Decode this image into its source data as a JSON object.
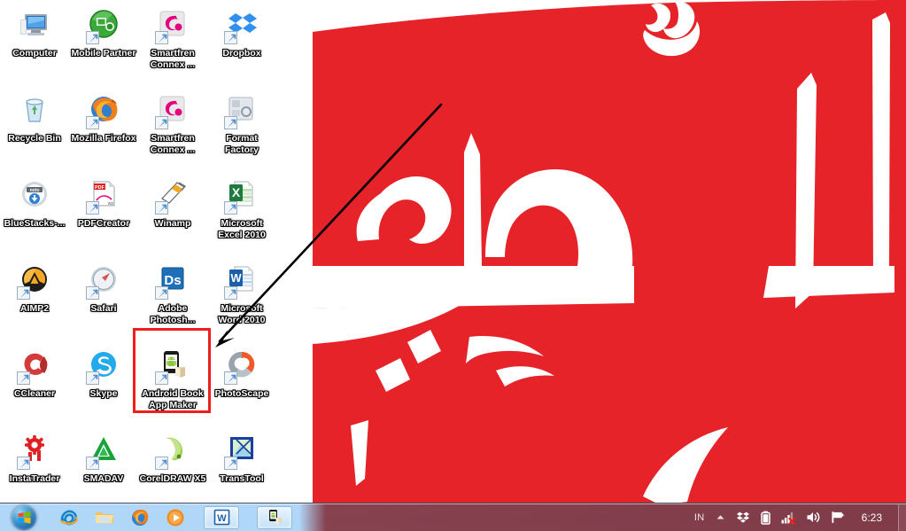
{
  "desktop": {
    "wallpaper": {
      "name": "arabic-calligraphy-wallpaper",
      "background_color": "#ffffff",
      "accent_color": "#e62329",
      "text_color": "#ffffff",
      "description": "Arabic calligraphy Ar-Raheem in white on red panel"
    },
    "icons": [
      {
        "label": "Computer",
        "icon": "computer-icon",
        "shortcut": false
      },
      {
        "label": "Mobile Partner",
        "icon": "mobile-partner-icon",
        "shortcut": true
      },
      {
        "label": "Smartfren Connex ...",
        "icon": "smartfren-connex-icon",
        "shortcut": true
      },
      {
        "label": "Dropbox",
        "icon": "dropbox-icon",
        "shortcut": true
      },
      {
        "label": "Recycle Bin",
        "icon": "recycle-bin-icon",
        "shortcut": false
      },
      {
        "label": "Mozilla Firefox",
        "icon": "firefox-icon",
        "shortcut": true
      },
      {
        "label": "Smartfren Connex ...",
        "icon": "smartfren-connex-icon",
        "shortcut": true
      },
      {
        "label": "Format Factory",
        "icon": "format-factory-icon",
        "shortcut": true
      },
      {
        "label": "BlueStacks-...",
        "icon": "bluestacks-icon",
        "shortcut": false
      },
      {
        "label": "PDFCreator",
        "icon": "pdfcreator-icon",
        "shortcut": true
      },
      {
        "label": "Winamp",
        "icon": "winamp-icon",
        "shortcut": true
      },
      {
        "label": "Microsoft Excel 2010",
        "icon": "excel-icon",
        "shortcut": true
      },
      {
        "label": "AIMP2",
        "icon": "aimp2-icon",
        "shortcut": true
      },
      {
        "label": "Safari",
        "icon": "safari-icon",
        "shortcut": true
      },
      {
        "label": "Adobe Photosh...",
        "icon": "photoshop-icon",
        "shortcut": true
      },
      {
        "label": "Microsoft Word 2010",
        "icon": "word-icon",
        "shortcut": true
      },
      {
        "label": "CCleaner",
        "icon": "ccleaner-icon",
        "shortcut": true
      },
      {
        "label": "Skype",
        "icon": "skype-icon",
        "shortcut": true
      },
      {
        "label": "Android Book App Maker",
        "icon": "android-book-app-maker-icon",
        "shortcut": true
      },
      {
        "label": "PhotoScape",
        "icon": "photoscape-icon",
        "shortcut": true
      },
      {
        "label": "InstaTrader",
        "icon": "instatrader-icon",
        "shortcut": true
      },
      {
        "label": "SMADAV",
        "icon": "smadav-icon",
        "shortcut": true
      },
      {
        "label": "CorelDRAW X5",
        "icon": "coreldraw-icon",
        "shortcut": true
      },
      {
        "label": "TransTool",
        "icon": "transtool-icon",
        "shortcut": true
      }
    ]
  },
  "annotations": {
    "highlight": {
      "name": "android-book-app-maker-highlight",
      "color": "#ef1d1d",
      "target_label": "Android Book App Maker"
    },
    "arrow": {
      "name": "pointer-arrow",
      "color": "#000000",
      "from": "498,118",
      "to": "243,390"
    }
  },
  "taskbar": {
    "start_button": {
      "label": "Start",
      "icon": "windows-start-orb"
    },
    "quick_launch": [
      {
        "label": "Internet Explorer",
        "icon": "internet-explorer-icon"
      },
      {
        "label": "Windows Explorer",
        "icon": "folder-explorer-icon"
      },
      {
        "label": "Mozilla Firefox",
        "icon": "firefox-icon"
      },
      {
        "label": "Windows Media Player",
        "icon": "media-player-icon"
      }
    ],
    "running_apps": [
      {
        "label": "Microsoft Word",
        "icon": "word-icon",
        "active": true
      },
      {
        "label": "Android Book App Maker",
        "icon": "android-book-app-maker-icon",
        "active": true
      }
    ],
    "tray": {
      "language": "IN",
      "show_hidden_label": "Show hidden icons",
      "icons": [
        {
          "label": "Dropbox",
          "icon": "dropbox-tray-icon"
        },
        {
          "label": "Battery",
          "icon": "battery-icon"
        },
        {
          "label": "Network - not connected",
          "icon": "network-disconnected-icon"
        },
        {
          "label": "Volume",
          "icon": "speaker-icon"
        },
        {
          "label": "Action Center",
          "icon": "flag-icon"
        }
      ],
      "clock": "6:23"
    }
  }
}
